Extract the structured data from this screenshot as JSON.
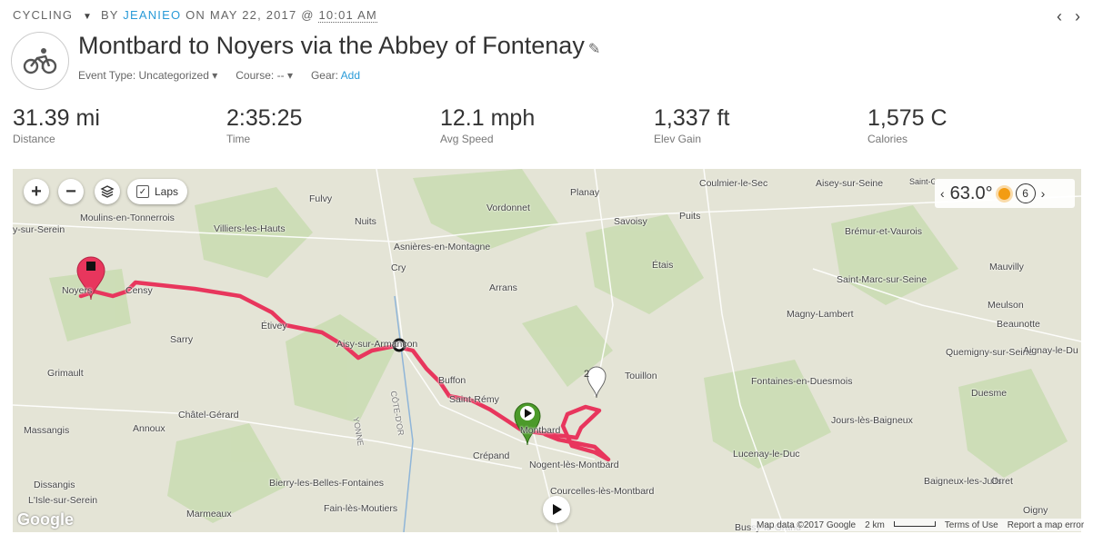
{
  "header": {
    "activity": "CYCLING",
    "by": "BY",
    "author": "JEANIEO",
    "on_date": "ON MAY 22, 2017 @",
    "time": "10:01 AM",
    "prev_icon": "chevron-left-icon",
    "next_icon": "chevron-right-icon"
  },
  "activity": {
    "title": "Montbard to Noyers via the Abbey of Fontenay",
    "event_type": "Event Type: Uncategorized",
    "course": "Course: --",
    "gear_label": "Gear:",
    "gear_add": "Add"
  },
  "stats": [
    {
      "value": "31.39 mi",
      "label": "Distance"
    },
    {
      "value": "2:35:25",
      "label": "Time"
    },
    {
      "value": "12.1 mph",
      "label": "Avg Speed"
    },
    {
      "value": "1,337 ft",
      "label": "Elev Gain"
    },
    {
      "value": "1,575 C",
      "label": "Calories"
    }
  ],
  "map": {
    "zoom_in": "+",
    "zoom_out": "−",
    "laps_label": "Laps",
    "temperature": "63.0°",
    "wind_badge": "6",
    "lap_marker": "2",
    "route_color": "#e8365d",
    "start_color": "#4c9a2a",
    "end_color": "#e8365d",
    "google": "Google",
    "attribution": {
      "map_data": "Map data ©2017 Google",
      "scale": "2 km",
      "terms": "Terms of Use",
      "report": "Report a map error"
    },
    "places": [
      "Fulvy",
      "Nuits",
      "Vordonnet",
      "Planay",
      "Coulmier-le-Sec",
      "Aisey-sur-Seine",
      "Saint-Germain-le-Rocheux",
      "Moulins-en-Tonnerrois",
      "y-sur-Serein",
      "Villiers-les-Hauts",
      "Savoisy",
      "Puits",
      "Asnières-en-Montagne",
      "Brémur-et-Vaurois",
      "Cry",
      "Mauvilly",
      "Noyers",
      "Censy",
      "Arrans",
      "Étais",
      "Saint-Marc-sur-Seine",
      "Meulson",
      "Étivey",
      "Magny-Lambert",
      "Beaunotte",
      "Sarry",
      "Aisy-sur-Armançon",
      "Quemigny-sur-Seine",
      "Aignay-le-Duc",
      "Grimault",
      "Buffon",
      "Touillon",
      "Fontaines-en-Duesmois",
      "Duesme",
      "Saint-Rémy",
      "Massangis",
      "Châtel-Gérard",
      "Annoux",
      "Montbard",
      "Jours-lès-Baigneux",
      "Crépand",
      "Lucenay-le-Duc",
      "Nogent-lès-Montbard",
      "Dissangis",
      "Baigneux-les-Juifs",
      "Orret",
      "Bierry-les-Belles-Fontaines",
      "L'Isle-sur-Serein",
      "Courcelles-lès-Montbard",
      "Oigny",
      "Marmeaux",
      "Fain-lès-Moutiers",
      "Bussy-le-Grand",
      "YONNE",
      "CÔTE-D'OR"
    ]
  }
}
